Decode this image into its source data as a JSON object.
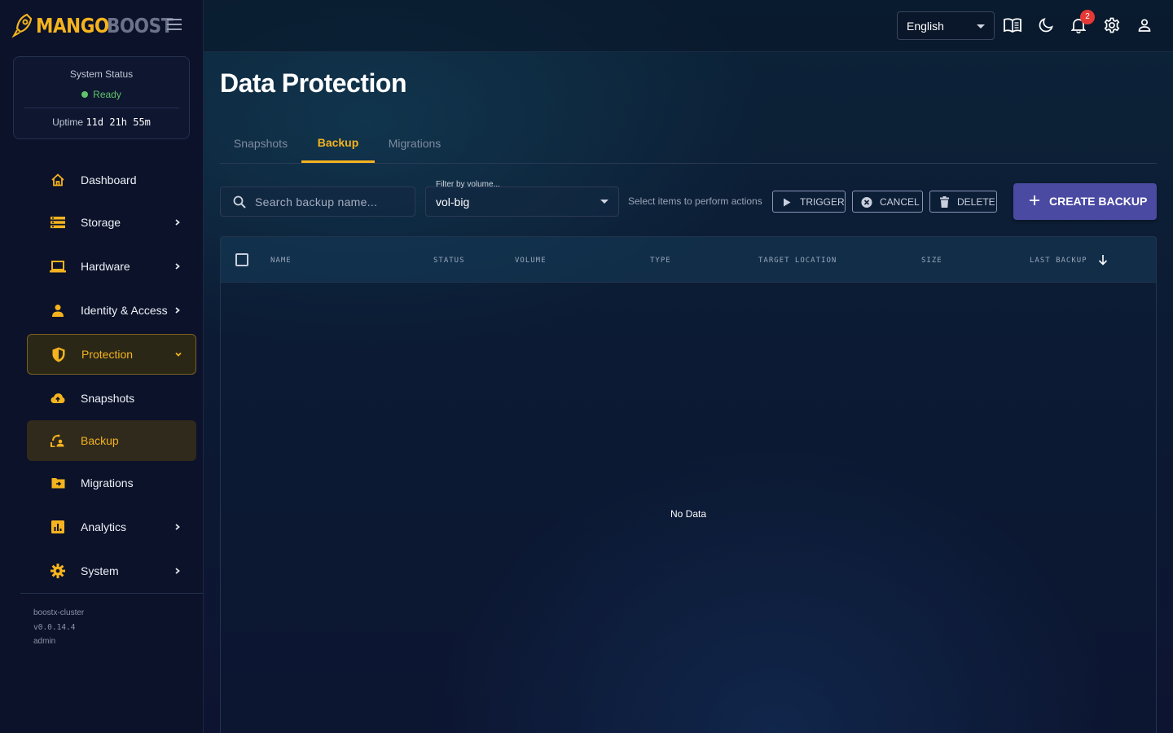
{
  "brand": {
    "part1": "MANGO",
    "part2": "BOOST"
  },
  "system_status": {
    "title": "System Status",
    "state": "Ready",
    "uptime_label": "Uptime",
    "uptime_value": "11d 21h 55m"
  },
  "nav": {
    "dashboard": "Dashboard",
    "storage": "Storage",
    "hardware": "Hardware",
    "identity": "Identity & Access",
    "protection": "Protection",
    "snapshots": "Snapshots",
    "backup": "Backup",
    "migrations": "Migrations",
    "analytics": "Analytics",
    "system": "System"
  },
  "footer": {
    "cluster": "boostx-cluster",
    "version": "v0.0.14.4",
    "user": "admin"
  },
  "topbar": {
    "language": "English",
    "notification_count": "2"
  },
  "page": {
    "title": "Data Protection"
  },
  "tabs": {
    "snapshots": "Snapshots",
    "backup": "Backup",
    "migrations": "Migrations"
  },
  "toolbar": {
    "search_placeholder": "Search backup name...",
    "filter_label": "Filter by volume...",
    "filter_value": "vol-big",
    "hint": "Select items to perform actions",
    "trigger": "TRIGGER",
    "cancel": "CANCEL",
    "delete": "DELETE",
    "create": "CREATE BACKUP"
  },
  "table": {
    "headers": {
      "name": "NAME",
      "status": "STATUS",
      "volume": "VOLUME",
      "type": "TYPE",
      "target": "TARGET LOCATION",
      "size": "SIZE",
      "last_backup": "LAST BACKUP"
    },
    "empty": "No Data"
  },
  "colors": {
    "accent": "#f5b31e",
    "primary_button": "#4a4aa3",
    "ready": "#5fc46a",
    "badge": "#e53935"
  }
}
